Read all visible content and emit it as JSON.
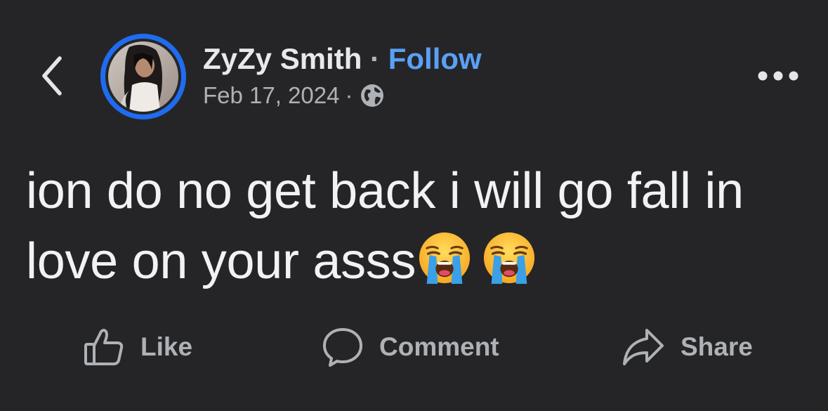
{
  "header": {
    "back_icon": "chevron-left-icon",
    "author_name": "ZyZy Smith",
    "separator": "·",
    "follow_label": "Follow",
    "date": "Feb 17, 2024",
    "meta_separator": "·",
    "audience_icon": "globe-icon",
    "more_icon": "more-horizontal-icon",
    "avatar_ring_color": "#1f6cf0",
    "follow_color": "#5aa0f5"
  },
  "post": {
    "text": "ion do no get back i will go fall in love on your asss",
    "emojis": [
      "loudly-crying-face-icon",
      "loudly-crying-face-icon"
    ]
  },
  "actions": {
    "like": {
      "label": "Like",
      "icon": "thumbs-up-icon"
    },
    "comment": {
      "label": "Comment",
      "icon": "comment-bubble-icon"
    },
    "share": {
      "label": "Share",
      "icon": "share-arrow-icon"
    }
  },
  "colors": {
    "background": "#252527",
    "text": "#f1f2f5",
    "secondary_text": "#aeb1b6"
  }
}
